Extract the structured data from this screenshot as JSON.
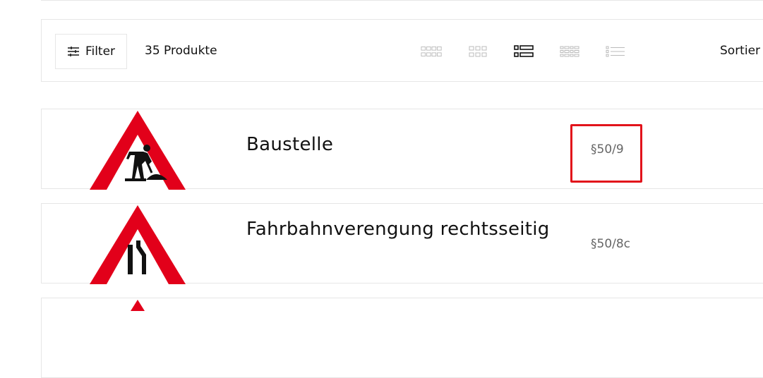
{
  "toolbar": {
    "filter_label": "Filter",
    "product_count": "35 Produkte",
    "view_modes": [
      "grid-4",
      "grid-3",
      "list-large",
      "list-grid",
      "list-compact"
    ],
    "active_view": "list-large",
    "sort_label": "Sortier"
  },
  "products": [
    {
      "title": "Baustelle",
      "code": "§50/9",
      "sign": "road-works-sign"
    },
    {
      "title": "Fahrbahnverengung rechtsseitig",
      "code": "§50/8c",
      "sign": "road-narrows-right-sign"
    }
  ],
  "colors": {
    "sign_red": "#e2001a",
    "highlight": "#e2131b",
    "border": "#e6e6e6"
  }
}
